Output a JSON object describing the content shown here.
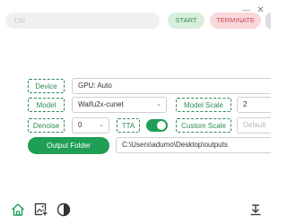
{
  "window": {
    "minimize_glyph": "—",
    "close_glyph": "✕"
  },
  "top_bar": {
    "prompt_placeholder": "ON",
    "start_label": "START",
    "terminate_label": "TERMINATE"
  },
  "settings": {
    "device": {
      "label": "Device",
      "value": "GPU: Auto"
    },
    "model": {
      "label": "Model",
      "value": "Waifu2x-cunet"
    },
    "model_scale": {
      "label": "Model Scale",
      "value": "2"
    },
    "denoise": {
      "label": "Denoise",
      "value": "0"
    },
    "tta": {
      "label": "TTA",
      "enabled": true
    },
    "custom_scale": {
      "label": "Custom Scale",
      "placeholder": "Default"
    },
    "output_folder": {
      "button_label": "Output Folder",
      "path": "C:\\Users\\adumo\\Desktop\\outputs"
    }
  },
  "toolbar": {
    "icons": [
      "home-icon",
      "add-image-icon",
      "theme-contrast-icon",
      "download-icon"
    ]
  },
  "colors": {
    "accent": "#1f9e55",
    "label_text": "#2e8b55",
    "start_bg": "#d8eedc",
    "terminate_bg": "#f9d8dc"
  }
}
